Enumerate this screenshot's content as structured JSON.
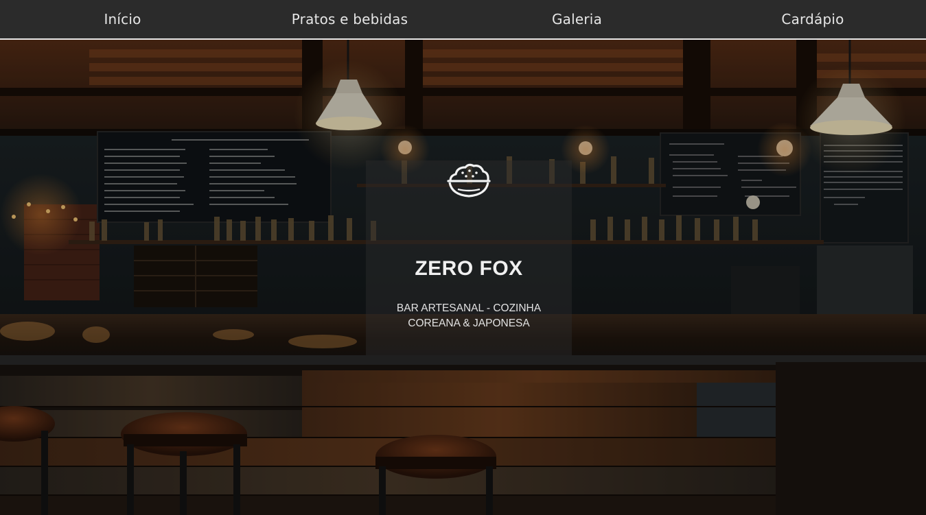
{
  "nav": {
    "items": [
      {
        "label": "Início"
      },
      {
        "label": "Pratos e bebidas"
      },
      {
        "label": "Galeria"
      },
      {
        "label": "Cardápio"
      }
    ]
  },
  "hero": {
    "icon": "food-bowl-icon",
    "brand": "ZERO FOX",
    "tagline": "BAR ARTESANAL - COZINHA COREANA & JAPONESA",
    "background_image": "dark bar interior with counter and stools"
  },
  "colors": {
    "nav_bg": "#2b2b2b",
    "nav_text": "#e6e6e6",
    "nav_border": "#e8e8e8",
    "overlay": "#2d2d2d"
  }
}
